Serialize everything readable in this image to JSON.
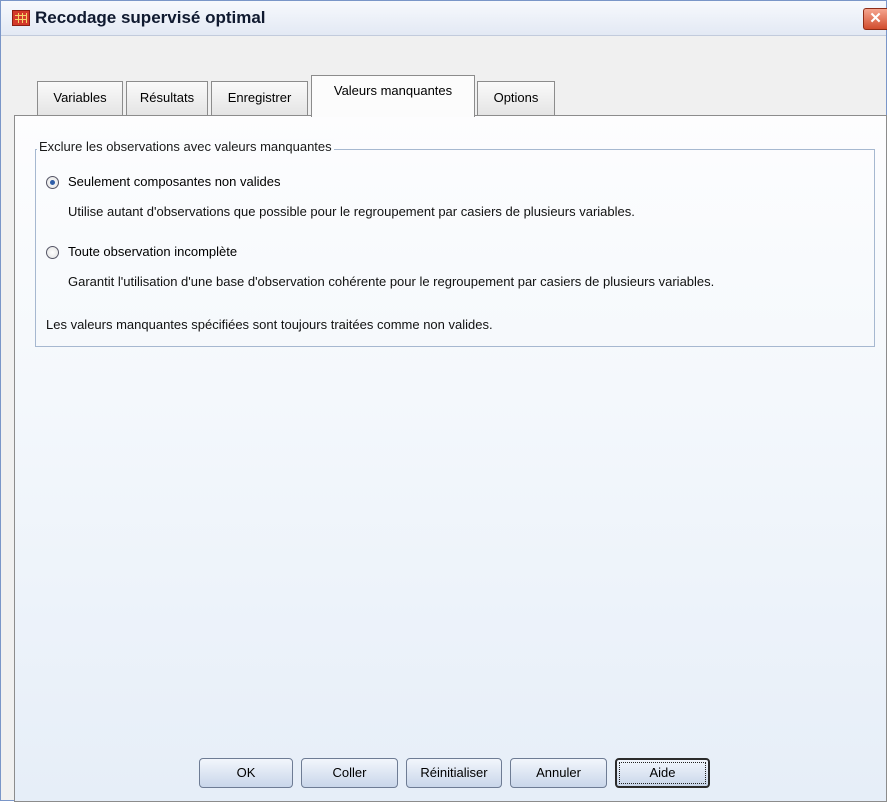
{
  "window": {
    "title": "Recodage supervisé optimal",
    "close_glyph": "✕"
  },
  "tabs": [
    {
      "label": "Variables",
      "active": false
    },
    {
      "label": "Résultats",
      "active": false
    },
    {
      "label": "Enregistrer",
      "active": false
    },
    {
      "label": "Valeurs manquantes",
      "active": true
    },
    {
      "label": "Options",
      "active": false
    }
  ],
  "group": {
    "label": "Exclure les observations avec valeurs manquantes",
    "options": [
      {
        "label": "Seulement composantes non valides",
        "description": "Utilise autant d'observations que possible pour le regroupement par casiers de plusieurs variables.",
        "selected": true
      },
      {
        "label": "Toute observation incomplète",
        "description": "Garantit l'utilisation d'une base d'observation cohérente pour le regroupement par casiers de plusieurs variables.",
        "selected": false
      }
    ],
    "note": "Les valeurs manquantes spécifiées sont toujours traitées comme non valides."
  },
  "buttons": {
    "ok": "OK",
    "paste": "Coller",
    "reset": "Réinitialiser",
    "cancel": "Annuler",
    "help": "Aide"
  },
  "icons": {
    "app": "spss-data-grid-icon",
    "close": "close-icon"
  }
}
